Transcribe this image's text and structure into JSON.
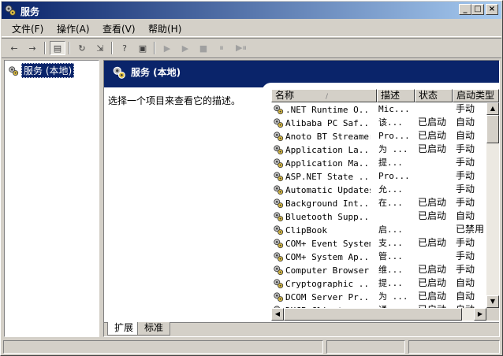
{
  "window": {
    "title": "服务"
  },
  "menu": {
    "items": [
      "文件(F)",
      "操作(A)",
      "查看(V)",
      "帮助(H)"
    ]
  },
  "toolbar": {
    "back": "←",
    "forward": "→",
    "show_tree": "▤",
    "refresh": "↻",
    "export": "⇲",
    "help": "?",
    "properties": "▣",
    "start": "▶",
    "start2": "▶",
    "stop": "■",
    "pause": "⏸",
    "restart": "▶⏸"
  },
  "tree": {
    "root_label": "服务 (本地)"
  },
  "pane": {
    "title": "服务 (本地)",
    "description": "选择一个项目来查看它的描述。"
  },
  "list": {
    "columns": {
      "name": "名称",
      "desc": "描述",
      "status": "状态",
      "startup": "启动类型"
    },
    "sort_indicator": "/",
    "rows": [
      {
        "name": ".NET Runtime O...",
        "desc": "Mic...",
        "status": "",
        "startup": "手动"
      },
      {
        "name": "Alibaba PC Saf...",
        "desc": "该...",
        "status": "已启动",
        "startup": "自动"
      },
      {
        "name": "Anoto BT Streamer",
        "desc": "Pro...",
        "status": "已启动",
        "startup": "自动"
      },
      {
        "name": "Application La...",
        "desc": "为 ...",
        "status": "已启动",
        "startup": "手动"
      },
      {
        "name": "Application Ma...",
        "desc": "提...",
        "status": "",
        "startup": "手动"
      },
      {
        "name": "ASP.NET State ...",
        "desc": "Pro...",
        "status": "",
        "startup": "手动"
      },
      {
        "name": "Automatic Updates",
        "desc": "允...",
        "status": "",
        "startup": "手动"
      },
      {
        "name": "Background Int...",
        "desc": "在...",
        "status": "已启动",
        "startup": "手动"
      },
      {
        "name": "Bluetooth Supp...",
        "desc": "",
        "status": "已启动",
        "startup": "自动"
      },
      {
        "name": "ClipBook",
        "desc": "启...",
        "status": "",
        "startup": "已禁用"
      },
      {
        "name": "COM+ Event System",
        "desc": "支...",
        "status": "已启动",
        "startup": "手动"
      },
      {
        "name": "COM+ System Ap...",
        "desc": "管...",
        "status": "",
        "startup": "手动"
      },
      {
        "name": "Computer Browser",
        "desc": "维...",
        "status": "已启动",
        "startup": "手动"
      },
      {
        "name": "Cryptographic ...",
        "desc": "提...",
        "status": "已启动",
        "startup": "自动"
      },
      {
        "name": "DCOM Server Pr...",
        "desc": "为 ...",
        "status": "已启动",
        "startup": "自动"
      },
      {
        "name": "DHCP Client",
        "desc": "通...",
        "status": "已启动",
        "startup": "自动"
      }
    ]
  },
  "tabs": {
    "extended": "扩展",
    "standard": "标准"
  },
  "colors": {
    "titlebar": "#0a246a",
    "window_bg": "#d4d0c8"
  }
}
